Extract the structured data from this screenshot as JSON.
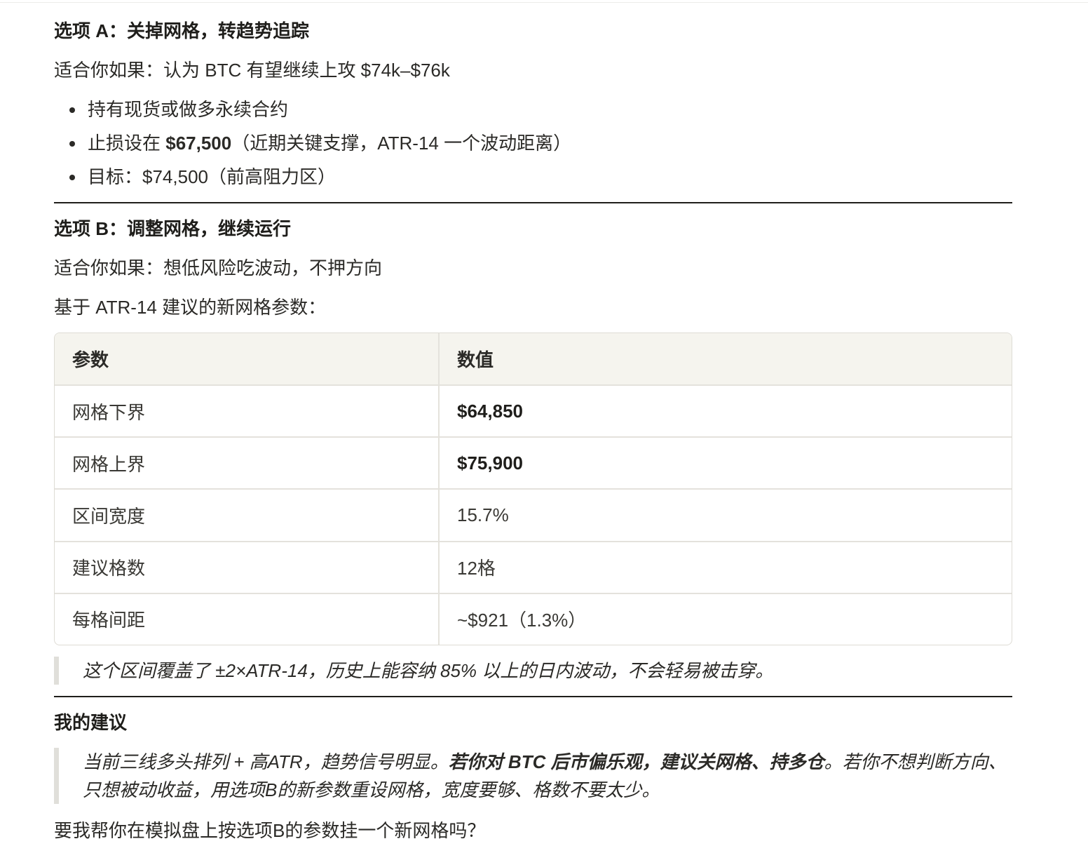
{
  "optionA": {
    "heading": "选项 A：关掉网格，转趋势追踪",
    "fit": "适合你如果：认为 BTC 有望继续上攻 $74k–$76k",
    "bullets": [
      {
        "pre": "持有现货或做多永续合约",
        "bold": "",
        "post": ""
      },
      {
        "pre": "止损设在 ",
        "bold": "$67,500",
        "post": "（近期关键支撑，ATR-14 一个波动距离）"
      },
      {
        "pre": "目标：$74,500（前高阻力区）",
        "bold": "",
        "post": ""
      }
    ]
  },
  "optionB": {
    "heading": "选项 B：调整网格，继续运行",
    "fit": "适合你如果：想低风险吃波动，不押方向",
    "intro": "基于 ATR-14 建议的新网格参数：",
    "table": {
      "headers": [
        "参数",
        "数值"
      ],
      "rows": [
        {
          "param": "网格下界",
          "value": "$64,850"
        },
        {
          "param": "网格上界",
          "value": "$75,900"
        },
        {
          "param": "区间宽度",
          "value": "15.7%"
        },
        {
          "param": "建议格数",
          "value": "12格"
        },
        {
          "param": "每格间距",
          "value": "~$921（1.3%）"
        }
      ]
    },
    "note": "这个区间覆盖了 ±2×ATR-14，历史上能容纳 85% 以上的日内波动，不会轻易被击穿。"
  },
  "recommendation": {
    "heading": "我的建议",
    "quote_pre": "当前三线多头排列 + 高ATR，趋势信号明显。",
    "quote_bold": "若你对 BTC 后市偏乐观，建议关网格、持多仓",
    "quote_post": "。若你不想判断方向、只想被动收益，用选项B的新参数重设网格，宽度要够、格数不要太少。",
    "question": "要我帮你在模拟盘上按选项B的参数挂一个新网格吗？"
  }
}
